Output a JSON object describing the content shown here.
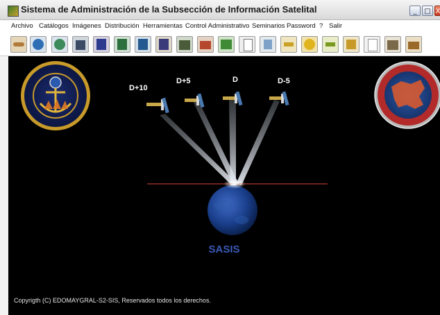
{
  "window": {
    "title": "Sistema de Administración de la Subsección de Información Satelital",
    "min_glyph": "_",
    "max_glyph": "□",
    "close_glyph": "X"
  },
  "menu": [
    "Archivo",
    "Catálogos",
    "Imágenes",
    "Distribución",
    "Herramientas",
    "Control Administrativo",
    "Seminarios",
    "Password",
    "?",
    "Salir"
  ],
  "toolbar_icons": [
    "handshake-icon",
    "globe-icon",
    "globe-network-icon",
    "building-icon",
    "book-icon",
    "book-edit-icon",
    "book-search-icon",
    "book-list-icon",
    "building-grid-icon",
    "folder-icon",
    "map-icon",
    "document-icon",
    "document-copy-icon",
    "satellite-icon",
    "disc-icon",
    "satellite-edit-icon",
    "edit-icon",
    "note-icon",
    "buildings-icon",
    "briefcase-icon"
  ],
  "main": {
    "satellites": [
      {
        "label": "D+10"
      },
      {
        "label": "D+5"
      },
      {
        "label": "D"
      },
      {
        "label": "D-5"
      }
    ],
    "left_emblem": "Armada de México - Estado Mayor General, S-2, Inteligencia Naval",
    "right_emblem": "Estado Mayor General de la Armada - Sección de Información Satelital",
    "product_name": "SASIS",
    "copyright": "Copyrigth (C) EDOMAYGRAL-S2-SIS, Reservados todos los derechos."
  },
  "colors": {
    "background": "#000000",
    "beam": "#cfd6df",
    "earth": "#1a3f8c",
    "product": "#3a5ab8",
    "horizon": "#c0392b"
  }
}
